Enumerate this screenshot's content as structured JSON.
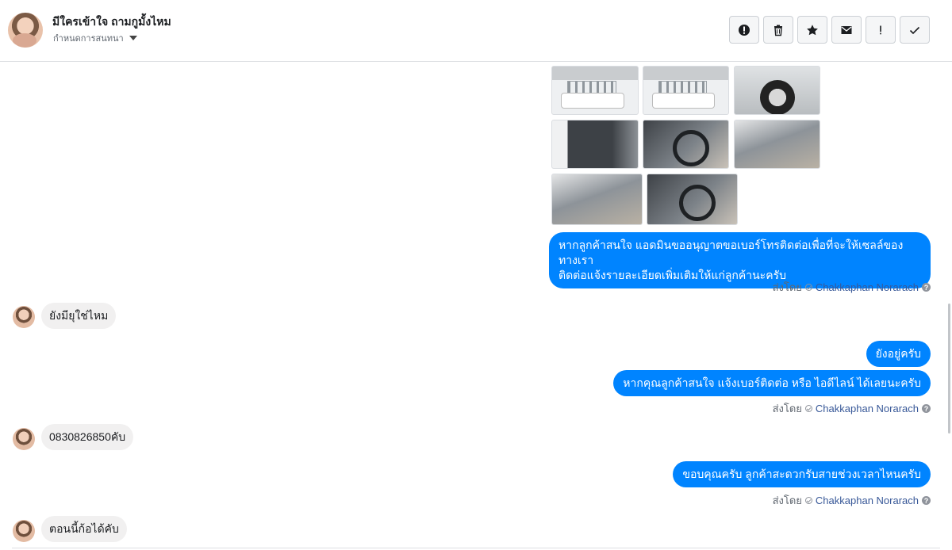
{
  "header": {
    "contact_name": "มีใครเข้าใจ ถามกูมั้งไหม",
    "subtitle": "กำหนดการสนทนา",
    "toolbar": [
      {
        "icon": "alert-circle-icon",
        "label": ""
      },
      {
        "icon": "trash-icon",
        "label": ""
      },
      {
        "icon": "star-icon",
        "label": ""
      },
      {
        "icon": "envelope-icon",
        "label": ""
      },
      {
        "icon": "exclamation-icon",
        "label": ""
      },
      {
        "icon": "checkmark-icon",
        "label": ""
      }
    ]
  },
  "messages": {
    "m1": "หากลูกค้าสนใจ แอดมินขออนุญาตขอเบอร์โทรติดต่อเพื่อที่จะให้เซลล์ของทางเรา",
    "m1b": "ติดต่อแจ้งรายละเอียดเพิ่มเติมให้แก่ลูกค้านะครับ",
    "in1": "ยังมียุใช่ไหม",
    "m2": "ยังอยู่ครับ",
    "m3": "หากคุณลูกค้าสนใจ แจ้งเบอร์ติดต่อ หรือ ไอดีไลน์ ได้เลยนะครับ",
    "in2": "0830826850คับ",
    "m4": "ขอบคุณครับ ลูกค้าสะดวกรับสายช่วงเวลาไหนครับ",
    "in3": "ตอนนี้ก้อได้คับ"
  },
  "sent_by": {
    "prefix": "ส่งโดย",
    "name": "Chakkaphan Norarach",
    "help": "?"
  },
  "colors": {
    "outgoing_bubble": "#0084ff",
    "incoming_bubble": "#f1f0f0",
    "link": "#385898"
  }
}
